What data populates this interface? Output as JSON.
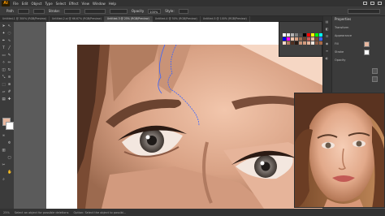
{
  "app": {
    "logo": "Ai"
  },
  "menu": [
    "File",
    "Edit",
    "Object",
    "Type",
    "Select",
    "Effect",
    "View",
    "Window",
    "Help"
  ],
  "control_bar": {
    "labels": [
      "Path",
      "Stroke:",
      "Opacity",
      "Style:"
    ],
    "opacity_value": "100%"
  },
  "tabs": [
    {
      "label": "Untitled-1 @ 300% (RGB/Preview)",
      "active": false
    },
    {
      "label": "Untitled-2.ai @ 66.67% (RGB/Preview)",
      "active": false
    },
    {
      "label": "Untitled-3 @ 25% (RGB/Preview)",
      "active": true
    },
    {
      "label": "Untitled-4 @ 50% (RGB/Preview)",
      "active": false
    },
    {
      "label": "Untitled-5 @ 100% (RGB/Preview)",
      "active": false
    }
  ],
  "panels": {
    "title": "Properties",
    "rows": [
      "Transform",
      "Appearance",
      "Fill",
      "Stroke",
      "Opacity"
    ]
  },
  "status": {
    "zoom": "25%",
    "hints": [
      "Select an object for possible deletions",
      "Option: Select the object to possibl..."
    ]
  },
  "colors": {
    "swatch_fill": "#e8b8a0",
    "swatch_stroke": "#ffffff",
    "selection_path": "#3a64ff"
  },
  "icons": {
    "tools": [
      "selection-icon",
      "direct-selection-icon",
      "magic-wand-icon",
      "lasso-icon",
      "pen-icon",
      "curvature-icon",
      "type-icon",
      "line-icon",
      "rectangle-icon",
      "paintbrush-icon",
      "shaper-icon",
      "pencil-icon",
      "eraser-icon",
      "rotate-icon",
      "scale-icon",
      "width-icon",
      "free-transform-icon",
      "shape-builder-icon",
      "perspective-icon",
      "mesh-icon",
      "gradient-icon",
      "eyedropper-icon",
      "blend-icon",
      "symbol-sprayer-icon",
      "column-graph-icon",
      "artboard-icon",
      "slice-icon",
      "hand-icon",
      "zoom-icon"
    ]
  }
}
